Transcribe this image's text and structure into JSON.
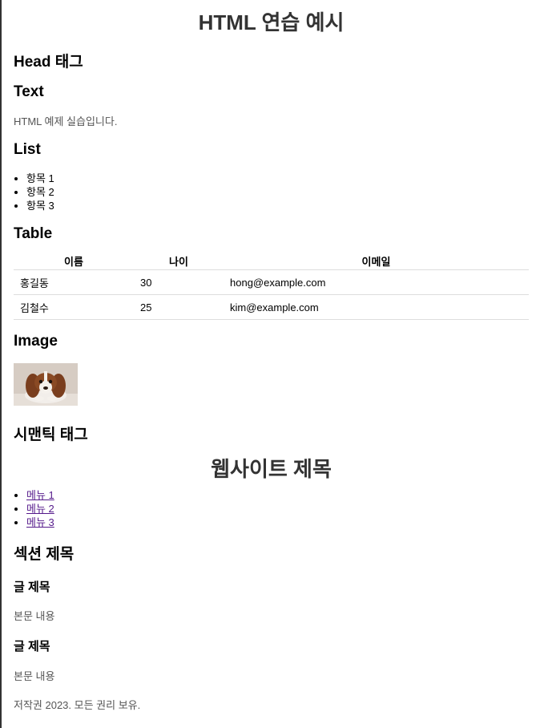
{
  "page_title": "HTML 연습 예시",
  "head_section": {
    "heading": "Head 태그"
  },
  "text_section": {
    "heading": "Text",
    "paragraph": "HTML 예제 실습입니다."
  },
  "list_section": {
    "heading": "List",
    "items": [
      "항목 1",
      "항목 2",
      "항목 3"
    ]
  },
  "table_section": {
    "heading": "Table",
    "headers": [
      "이름",
      "나이",
      "이메일"
    ],
    "rows": [
      [
        "홍길동",
        "30",
        "hong@example.com"
      ],
      [
        "김철수",
        "25",
        "kim@example.com"
      ]
    ]
  },
  "image_section": {
    "heading": "Image",
    "image_icon": "dog-photo"
  },
  "semantic_section": {
    "heading": "시맨틱 태그",
    "site_title": "웹사이트 제목",
    "nav": [
      "메뉴 1",
      "메뉴 2",
      "메뉴 3"
    ],
    "section_title": "섹션 제목",
    "articles": [
      {
        "title": "글 제목",
        "body": "본문 내용"
      },
      {
        "title": "글 제목",
        "body": "본문 내용"
      }
    ],
    "footer": "저작권 2023. 모든 권리 보유."
  },
  "colors": {
    "link": "#551a8b",
    "heading": "#333333",
    "text": "#555555",
    "border": "#dddddd"
  }
}
